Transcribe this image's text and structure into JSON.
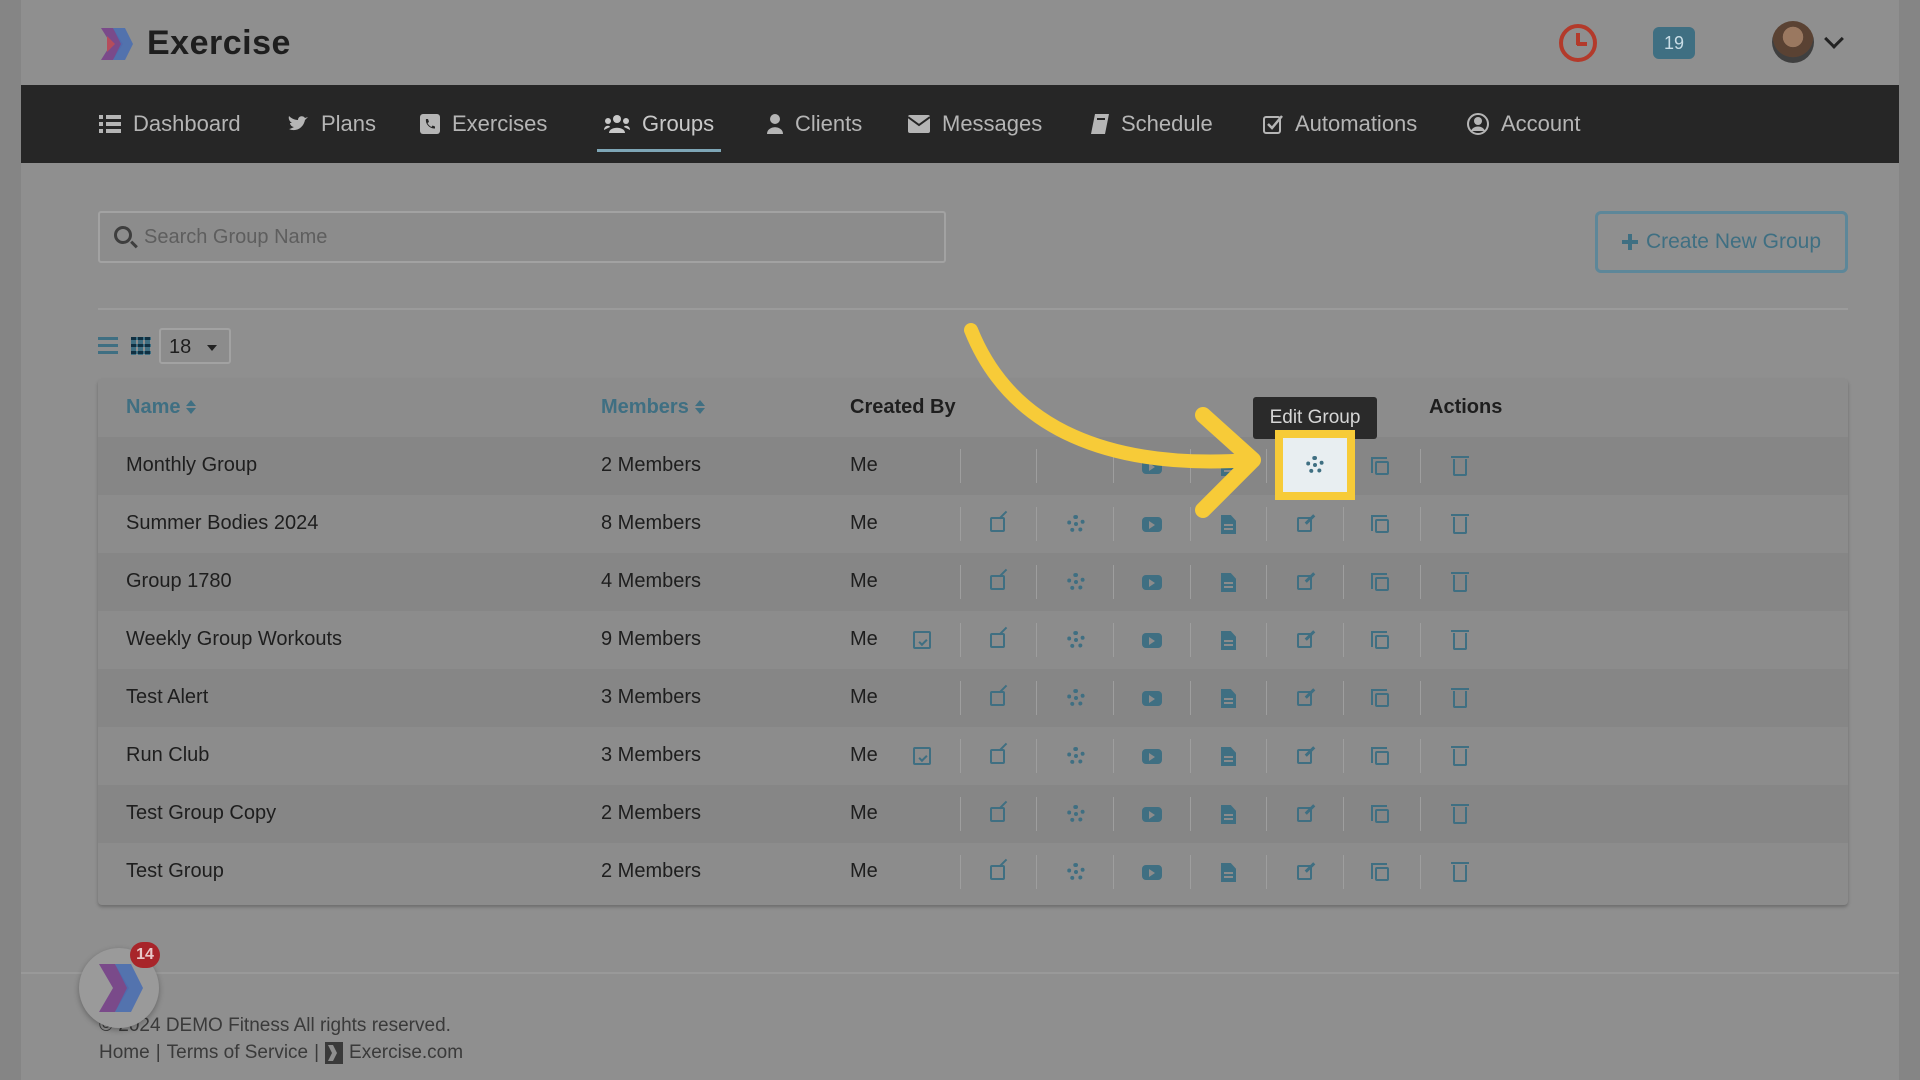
{
  "app": {
    "name": "Exercise",
    "notification_count": "19",
    "chat_badge_count": "14",
    "accent_color": "#3f6f82",
    "highlight_color": "#f7cb38"
  },
  "nav": {
    "items": [
      {
        "label": "Dashboard",
        "icon": "list-icon"
      },
      {
        "label": "Plans",
        "icon": "twitter-bird-icon"
      },
      {
        "label": "Exercises",
        "icon": "phone-square-icon"
      },
      {
        "label": "Groups",
        "icon": "users-icon",
        "active": true
      },
      {
        "label": "Clients",
        "icon": "user-icon"
      },
      {
        "label": "Messages",
        "icon": "envelope-icon"
      },
      {
        "label": "Schedule",
        "icon": "book-icon"
      },
      {
        "label": "Automations",
        "icon": "check-square-icon"
      },
      {
        "label": "Account",
        "icon": "user-circle-icon"
      }
    ]
  },
  "search": {
    "placeholder": "Search Group Name",
    "value": ""
  },
  "toolbar": {
    "create_label": "Create New Group",
    "page_size": "18"
  },
  "table": {
    "headers": {
      "name": "Name",
      "members": "Members",
      "created_by": "Created By",
      "actions": "Actions"
    },
    "rows": [
      {
        "name": "Monthly Group",
        "members": "2 Members",
        "created_by": "Me",
        "calendar": false
      },
      {
        "name": "Summer Bodies 2024",
        "members": "8 Members",
        "created_by": "Me",
        "calendar": false
      },
      {
        "name": "Group 1780",
        "members": "4 Members",
        "created_by": "Me",
        "calendar": false
      },
      {
        "name": "Weekly Group Workouts",
        "members": "9 Members",
        "created_by": "Me",
        "calendar": true
      },
      {
        "name": "Test Alert",
        "members": "3 Members",
        "created_by": "Me",
        "calendar": false
      },
      {
        "name": "Run Club",
        "members": "3 Members",
        "created_by": "Me",
        "calendar": true
      },
      {
        "name": "Test Group Copy",
        "members": "2 Members",
        "created_by": "Me",
        "calendar": false
      },
      {
        "name": "Test Group",
        "members": "2 Members",
        "created_by": "Me",
        "calendar": false
      }
    ]
  },
  "tooltip": {
    "label": "Edit Group"
  },
  "footer": {
    "copyright": "© 2024 DEMO Fitness All rights reserved.",
    "home": "Home",
    "terms": "Terms of Service",
    "site": "Exercise.com",
    "separator": "|"
  }
}
